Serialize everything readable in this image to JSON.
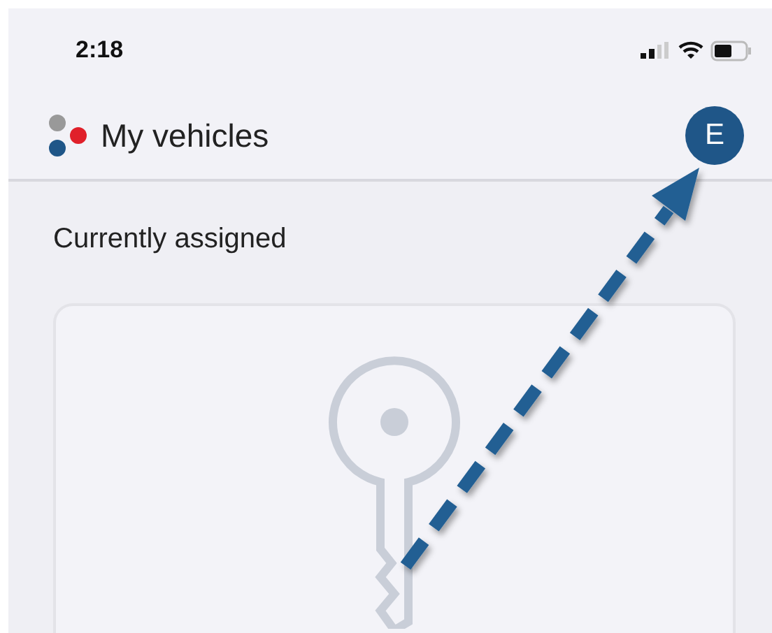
{
  "status_bar": {
    "time": "2:18"
  },
  "header": {
    "title": "My vehicles",
    "avatar": "E"
  },
  "section": {
    "title": "Currently assigned"
  }
}
